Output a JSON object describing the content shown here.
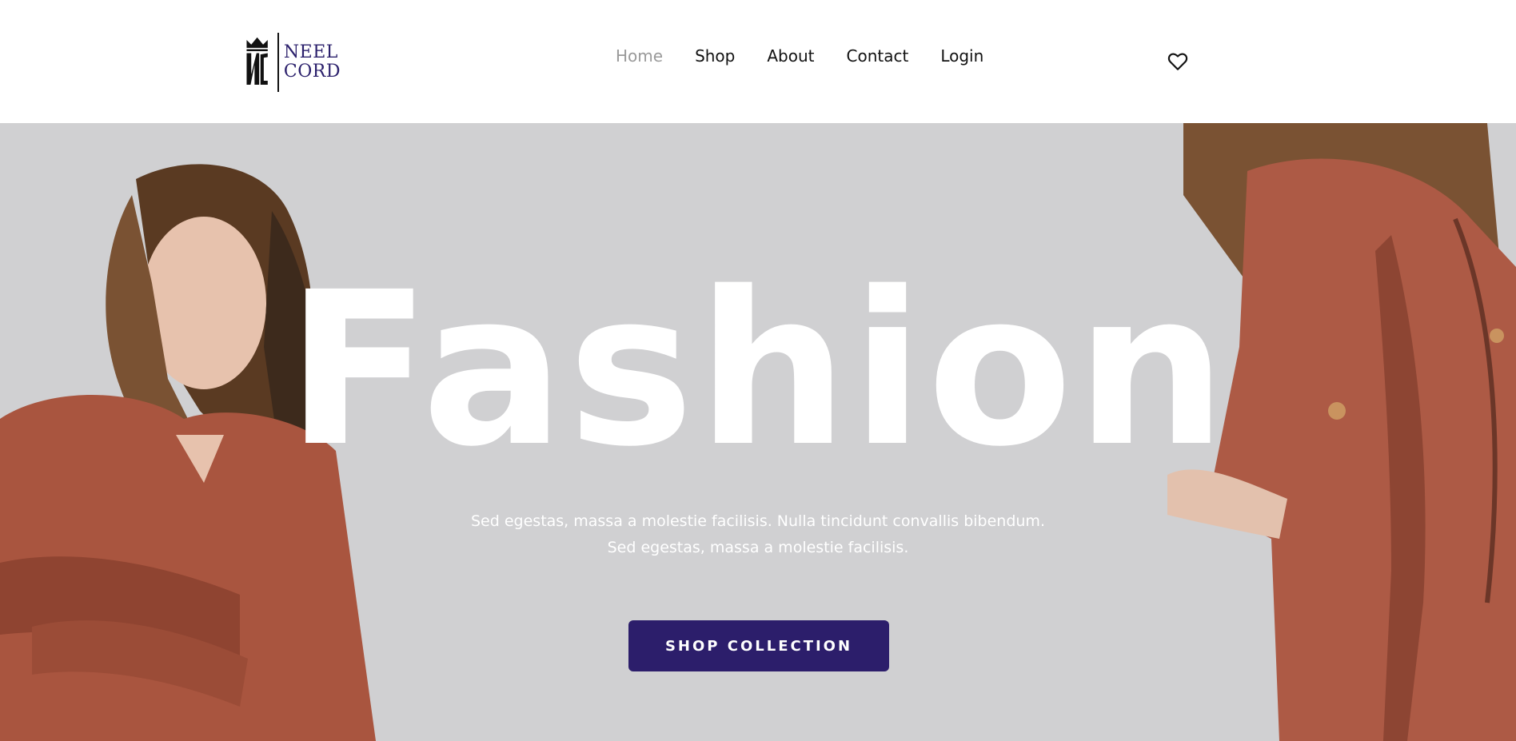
{
  "brand": {
    "line1": "NEEL",
    "line2": "CORD",
    "monogram": "NC",
    "color": "#2a1f6b"
  },
  "nav": {
    "items": [
      {
        "label": "Home",
        "active": true
      },
      {
        "label": "Shop",
        "active": false
      },
      {
        "label": "About",
        "active": false
      },
      {
        "label": "Contact",
        "active": false
      },
      {
        "label": "Login",
        "active": false
      }
    ]
  },
  "header": {
    "wishlist_icon": "heart-icon"
  },
  "hero": {
    "headline": "Fashion",
    "subtext_line1": "Sed egestas, massa a molestie facilisis. Nulla tincidunt convallis bibendum.",
    "subtext_line2": "Sed egestas, massa a molestie facilisis.",
    "cta_label": "SHOP COLLECTION",
    "background_color": "#d0d0d2",
    "cta_color": "#2c1e6b"
  }
}
